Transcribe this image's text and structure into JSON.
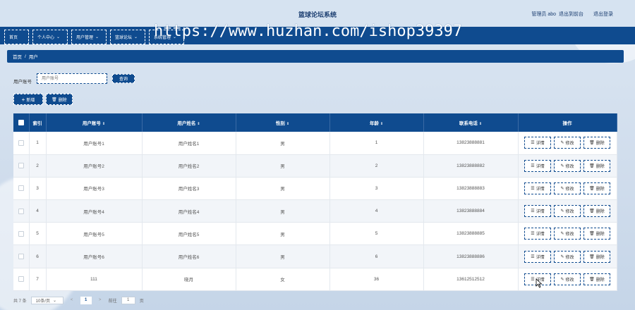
{
  "header": {
    "title": "篮球论坛系统",
    "admin": "管理员 abo",
    "back_link": "退出到前台",
    "logout_link": "退出登录"
  },
  "watermark": "https://www.huzhan.com/ishop39397",
  "nav": {
    "items": [
      {
        "label": "首页",
        "chevron": ""
      },
      {
        "label": "个人中心",
        "chevron": "⌄"
      },
      {
        "label": "用户管理",
        "chevron": "⌄"
      },
      {
        "label": "篮球论坛",
        "chevron": "⌄"
      },
      {
        "label": "系统管理",
        "chevron": "⌄"
      }
    ]
  },
  "breadcrumb": {
    "home": "首页",
    "sep": "/",
    "current": "用户"
  },
  "search": {
    "label": "用户账号",
    "placeholder": "用户账号",
    "button": "查询"
  },
  "actions": {
    "add": "新增",
    "add_icon": "+",
    "delete": "删除",
    "delete_icon": "🗑"
  },
  "table": {
    "headers": [
      "索引",
      "用户账号",
      "用户姓名",
      "性别",
      "年龄",
      "联系电话",
      "操作"
    ],
    "sort_icon": "⇕",
    "rows": [
      {
        "index": "1",
        "account": "用户账号1",
        "name": "用户姓名1",
        "gender": "男",
        "age": "1",
        "phone": "13823888881"
      },
      {
        "index": "2",
        "account": "用户账号2",
        "name": "用户姓名2",
        "gender": "男",
        "age": "2",
        "phone": "13823888882"
      },
      {
        "index": "3",
        "account": "用户账号3",
        "name": "用户姓名3",
        "gender": "男",
        "age": "3",
        "phone": "13823888883"
      },
      {
        "index": "4",
        "account": "用户账号4",
        "name": "用户姓名4",
        "gender": "男",
        "age": "4",
        "phone": "13823888884"
      },
      {
        "index": "5",
        "account": "用户账号5",
        "name": "用户姓名5",
        "gender": "男",
        "age": "5",
        "phone": "13823888885"
      },
      {
        "index": "6",
        "account": "用户账号6",
        "name": "用户姓名6",
        "gender": "男",
        "age": "6",
        "phone": "13823888886"
      },
      {
        "index": "7",
        "account": "111",
        "name": "晓月",
        "gender": "女",
        "age": "36",
        "phone": "13612512512"
      }
    ],
    "op_labels": {
      "detail": "详情",
      "edit": "修改",
      "delete": "删除"
    },
    "op_icons": {
      "detail": "☰",
      "edit": "✎",
      "delete": "🗑"
    }
  },
  "pager": {
    "total": "共 7 条",
    "page_size": "10条/页",
    "prev": "<",
    "current": "1",
    "next": ">",
    "goto_label": "前往",
    "goto_value": "1",
    "page_unit": "页"
  },
  "colors": {
    "primary": "#0f4b8f",
    "background": "#d6e3f1"
  }
}
